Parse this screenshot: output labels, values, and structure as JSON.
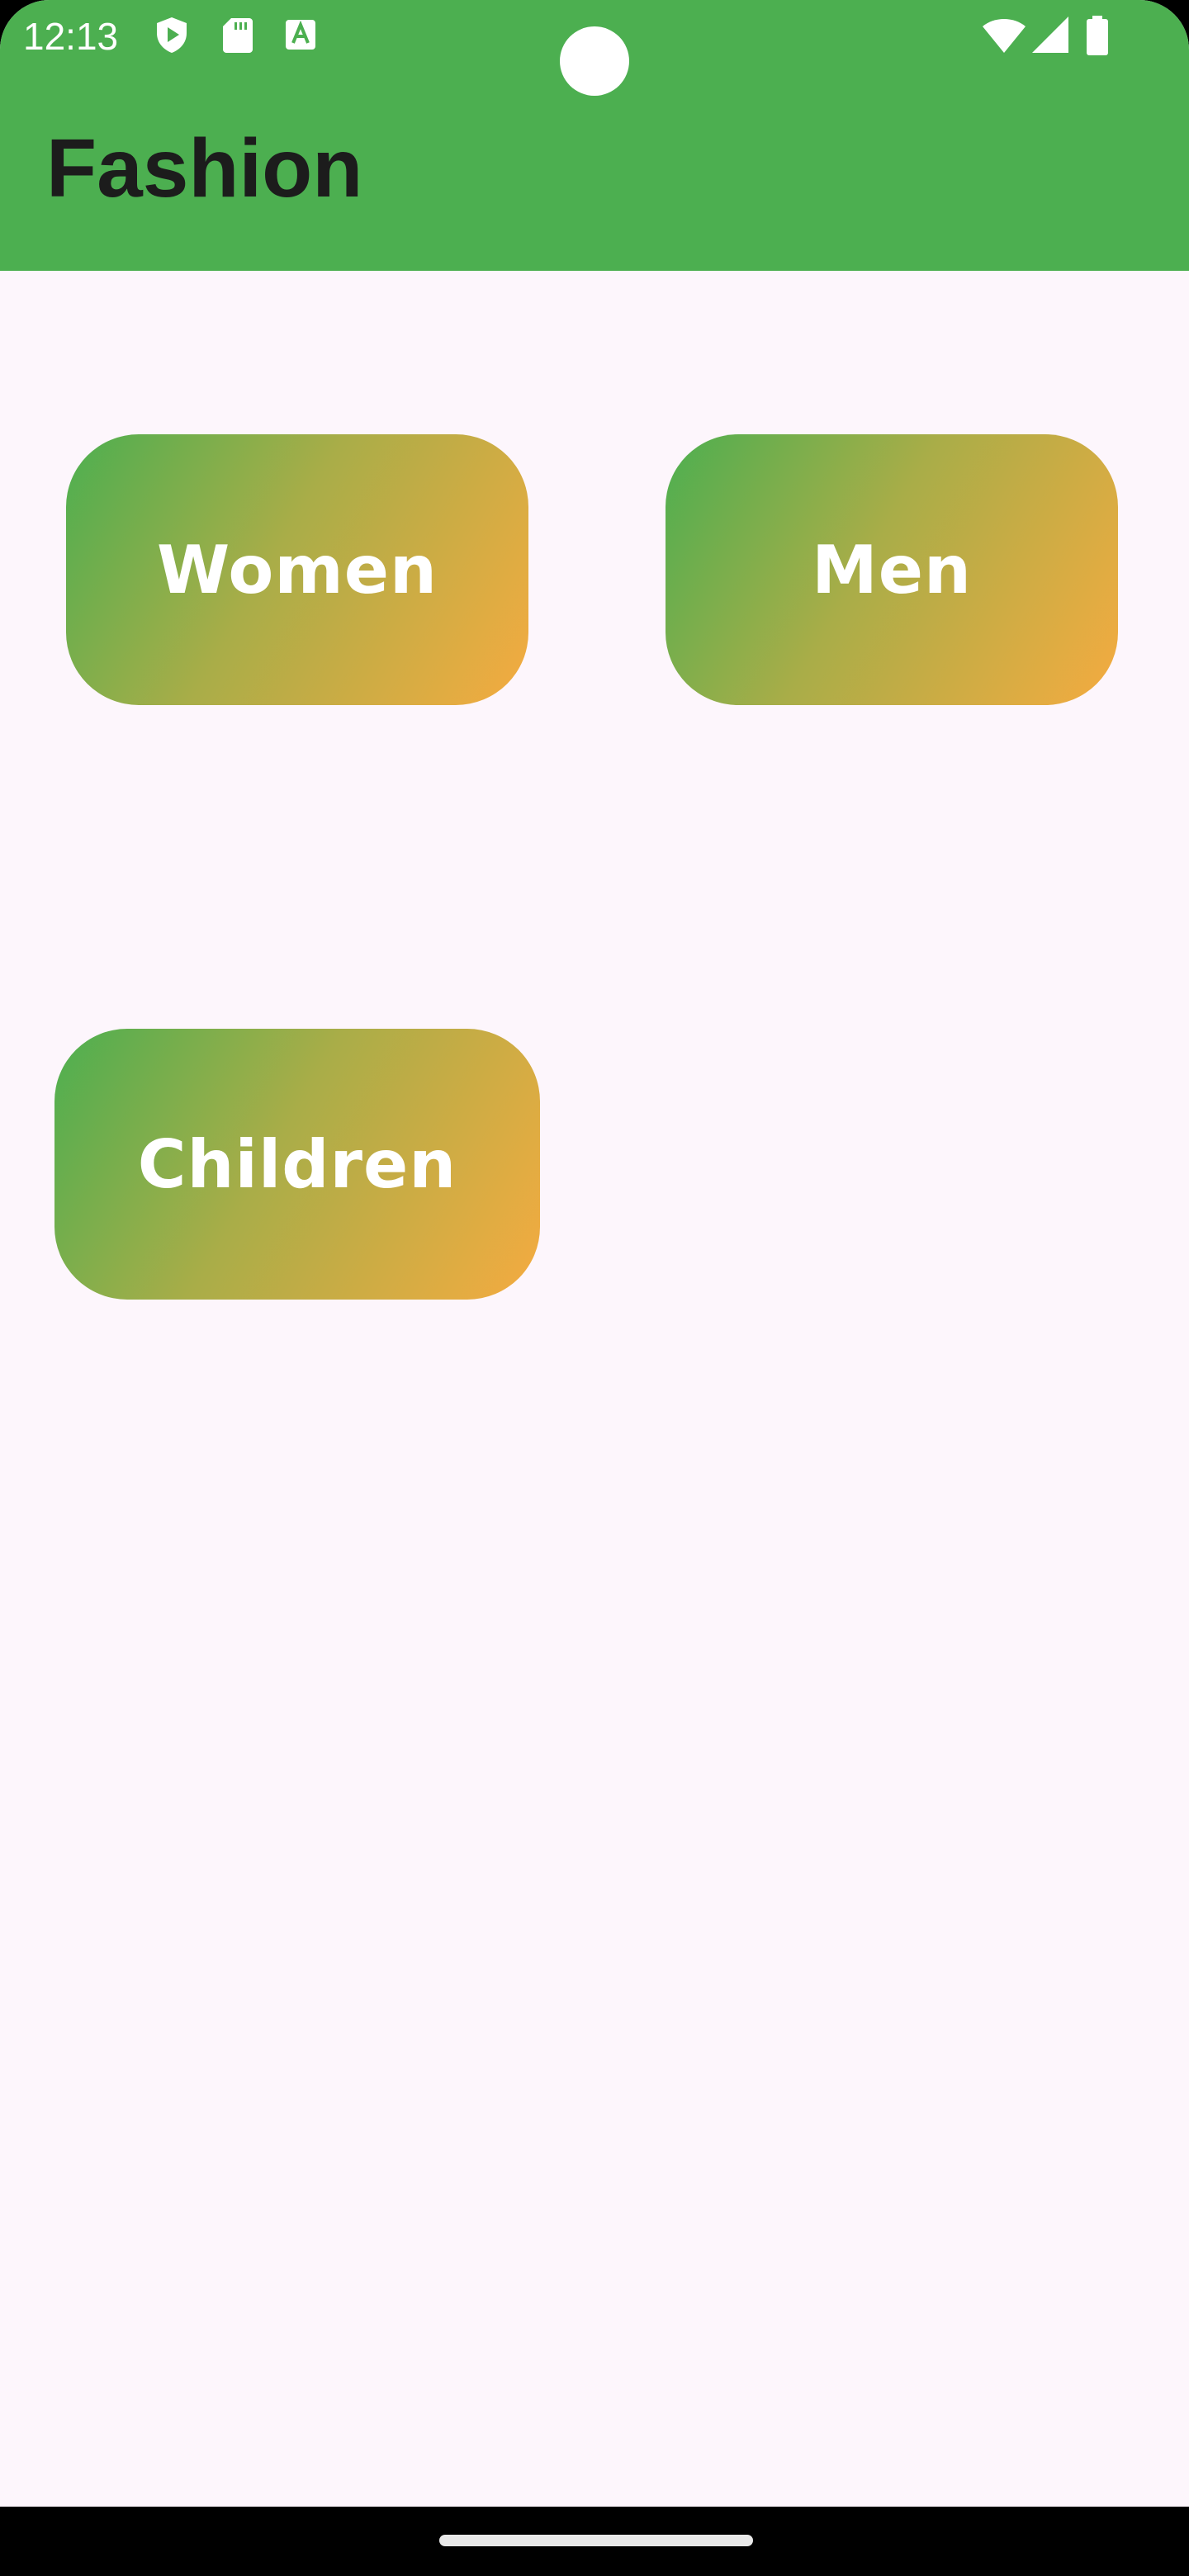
{
  "status_bar": {
    "time": "12:13",
    "left_icons": [
      "play-protect-icon",
      "sd-card-icon",
      "font-a-icon"
    ],
    "right_icons": [
      "wifi-icon",
      "signal-icon",
      "battery-icon"
    ]
  },
  "app_bar": {
    "title": "Fashion",
    "color": "#4caf50"
  },
  "categories": [
    {
      "label": "Women"
    },
    {
      "label": "Men"
    },
    {
      "label": "Children"
    }
  ],
  "colors": {
    "gradient_start": "#4caf50",
    "gradient_end": "#f5ab40",
    "background": "#fdf6fc"
  }
}
